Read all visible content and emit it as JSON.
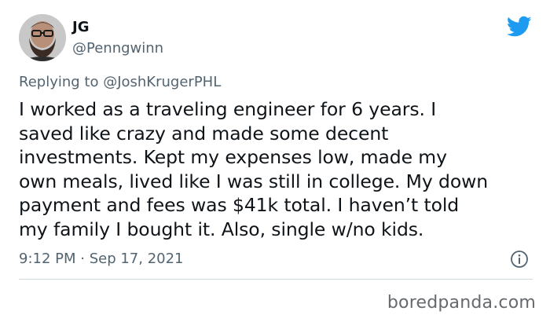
{
  "user": {
    "name": "JG",
    "handle": "@Penngwinn"
  },
  "reply": {
    "prefix": "Replying to ",
    "mention": "@JoshKrugerPHL"
  },
  "tweet": {
    "lines": [
      "I worked as a traveling engineer for 6 years. I",
      "saved like crazy and made some decent",
      "investments. Kept my expenses low, made my",
      "own meals, lived like I was still in college. My down",
      "payment and fees was $41k total. I haven’t told",
      "my family I bought it. Also, single w/no kids."
    ]
  },
  "meta": {
    "timestamp": "9:12 PM · Sep 17, 2021"
  },
  "watermark": "boredpanda.com",
  "colors": {
    "text": "#0f1419",
    "secondary": "#536471",
    "twitter_blue": "#1d9bf0",
    "divider": "#cfd9de"
  },
  "icons": {
    "brand": "twitter-bird-icon",
    "info": "info-icon"
  }
}
